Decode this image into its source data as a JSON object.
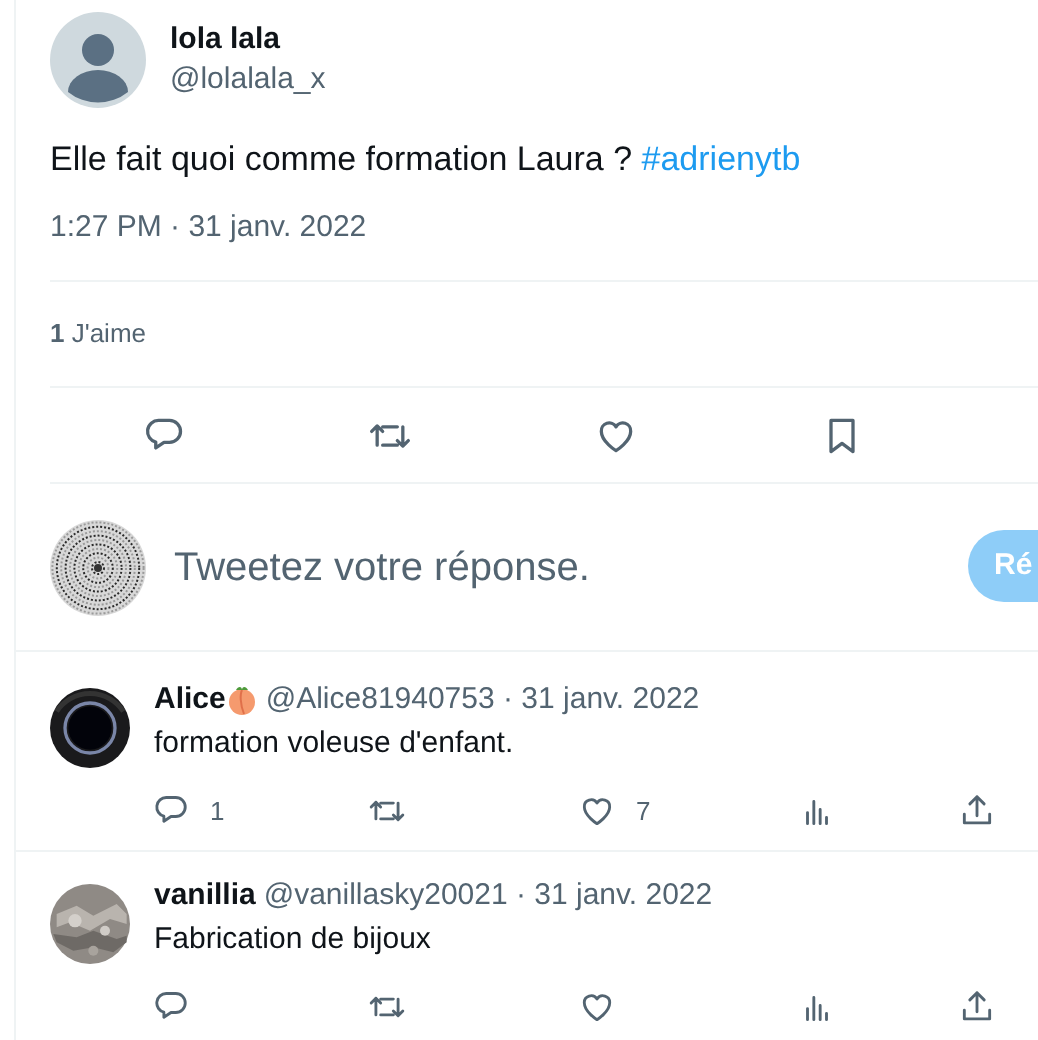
{
  "tweet": {
    "name": "lola lala",
    "handle": "@lolalala_x",
    "text": "Elle fait quoi comme formation Laura ?",
    "hashtag": "#adrienytb",
    "timestamp": "1:27 PM · 31 janv. 2022",
    "likes": "**1** J'aime",
    "actions": [
      {
        "kind": "reply"
      },
      {
        "kind": "retweet"
      },
      {
        "kind": "like"
      },
      {
        "kind": "bookmark"
      }
    ]
  },
  "composer": {
    "placeholder": "Tweetez votre réponse.",
    "button": "Ré"
  },
  "replies": [
    {
      "name": "Alice",
      "emoji_badge": true,
      "meta": "@Alice81940753 · 31 janv. 2022",
      "text": "formation voleuse d'enfant.",
      "actions": [
        {
          "kind": "reply",
          "count": "1"
        },
        {
          "kind": "retweet"
        },
        {
          "kind": "like",
          "count": "7"
        },
        {
          "kind": "views"
        },
        {
          "kind": "share"
        }
      ]
    },
    {
      "name": "vanillia",
      "emoji_badge": false,
      "meta": "@vanillasky20021 · 31 janv. 2022",
      "text": "Fabrication de bijoux",
      "actions": [
        {
          "kind": "reply"
        },
        {
          "kind": "retweet"
        },
        {
          "kind": "like"
        },
        {
          "kind": "views"
        },
        {
          "kind": "share"
        }
      ]
    }
  ]
}
